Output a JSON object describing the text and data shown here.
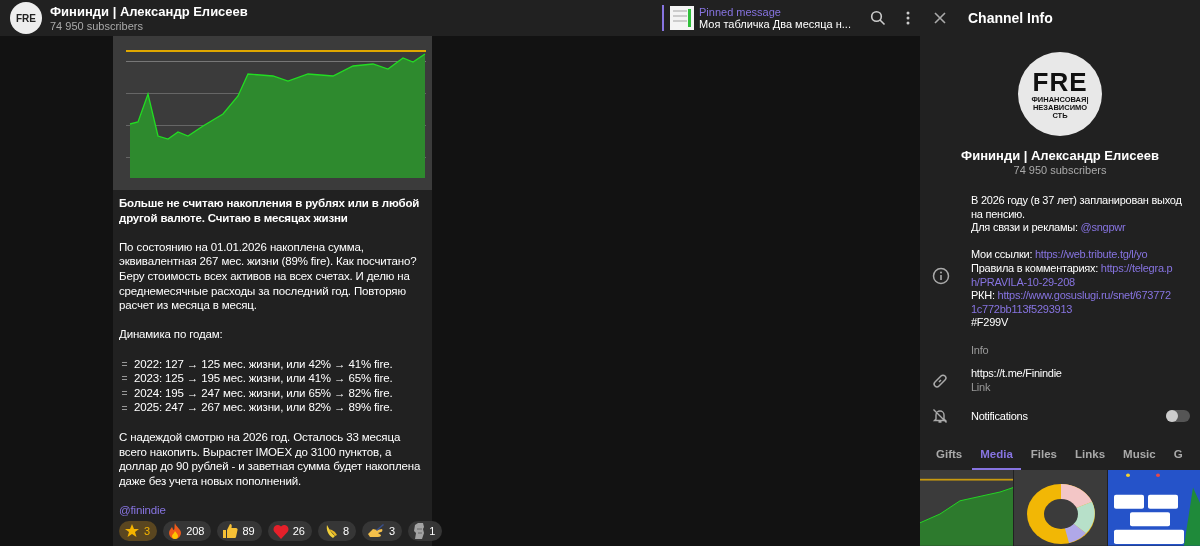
{
  "header": {
    "avatar_letters": "FRE",
    "title": "Фининди | Александр Елисеев",
    "subscribers": "74 950 subscribers",
    "pinned": {
      "label": "Pinned message",
      "text": "Моя табличка Два месяца н..."
    }
  },
  "message": {
    "image": {
      "kind": "picture"
    },
    "heading": "Больше не считаю накопления в рублях или в любой другой валюте. Считаю в месяцах жизни",
    "paragraphs": [
      "По состоянию на 01.01.2026 накоплена сумма, эквивалентная 267 мес. жизни (89% fire). Как посчитано? Беру стоимость всех активов на всех счетах. И делю на среднемесячные расходы за последний год. Повторяю расчет из месяца в месяц.",
      "Динамика по годам:"
    ],
    "list": [
      "2022: 127 → 125 мес. жизни, или 42% → 41% fire.",
      "2023: 125 → 195 мес. жизни, или 41% → 65% fire.",
      "2024: 195 → 247 мес. жизни, или 65% → 82% fire.",
      "2025: 247 → 267 мес. жизни, или 82% → 89% fire."
    ],
    "closing": "С надеждой смотрю на 2026 год. Осталось 33 месяца всего накопить. Вырастет IMOEX до 3100 пунктов, а доллар до 90 рублей - и заветная сумма будет накоплена даже без учета новых пополнений.",
    "signature": "@finindie",
    "reactions": [
      {
        "kind": "star",
        "count": "3"
      },
      {
        "kind": "fire",
        "count": "208"
      },
      {
        "kind": "thumbs_up",
        "count": "89"
      },
      {
        "kind": "heart",
        "count": "26"
      },
      {
        "kind": "banana",
        "count": "8"
      },
      {
        "kind": "writing_hand",
        "count": "3"
      },
      {
        "kind": "moai",
        "count": "1"
      }
    ]
  },
  "panel": {
    "title": "Channel Info",
    "logo": {
      "letters": "FRE",
      "tagline": "ФИНАНСОВАЯ|НЕЗАВИСИМОСТЬ"
    },
    "name": "Фининди | Александр Елисеев",
    "subscribers": "74 950 subscribers",
    "info": {
      "paragraphs": [
        [
          {
            "text": "В 2026 году (в 37 лет) запланирован выход на пенсию."
          },
          {
            "text": "Для связи и рекламы: ",
            "link": "@sngpwr"
          }
        ],
        [
          {
            "text": "Мои ссылки: ",
            "link": "https://web.tribute.tg/l/yo"
          },
          {
            "text": "Правила в комментариях: ",
            "link": "https://telegra.p"
          },
          {
            "link": "h/PRAVILA-10-29-208"
          },
          {
            "text": "РКН: ",
            "link": "https://www.gosuslugi.ru/snet/673772"
          },
          {
            "link": "1c772bb113f5293913"
          },
          {
            "text": "#F299V"
          }
        ]
      ],
      "caption": "Info"
    },
    "link": {
      "value": "https://t.me/Finindie",
      "caption": "Link"
    },
    "notifications": {
      "label": "Notifications",
      "on": false
    },
    "tabs": [
      {
        "label": "Gifts",
        "selected": false
      },
      {
        "label": "Media",
        "selected": true
      },
      {
        "label": "Files",
        "selected": false
      },
      {
        "label": "Links",
        "selected": false
      },
      {
        "label": "Music",
        "selected": false
      },
      {
        "label": "G",
        "selected": false
      }
    ],
    "media": [
      {
        "kind": "picture"
      },
      {
        "kind": "picture"
      },
      {
        "kind": "picture"
      }
    ]
  }
}
